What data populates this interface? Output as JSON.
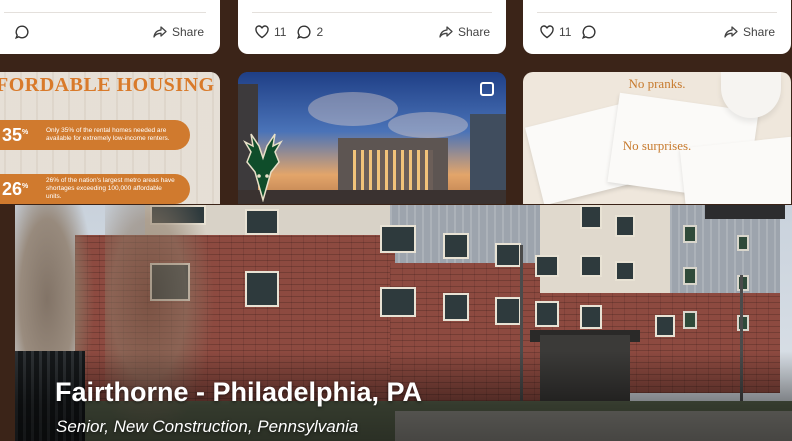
{
  "posts": [
    {
      "likes": "",
      "comments": "",
      "share_label": "Share"
    },
    {
      "likes": "11",
      "comments": "2",
      "share_label": "Share"
    },
    {
      "likes": "11",
      "comments": "",
      "share_label": "Share"
    }
  ],
  "tiles": {
    "housing": {
      "title": "FORDABLE HOUSING",
      "stats": [
        {
          "value": "35",
          "unit": "%",
          "text": "Only 35% of the rental homes needed are available for extremely low-income renters."
        },
        {
          "value": "26",
          "unit": "%",
          "text": "26% of the nation's largest metro areas have shortages exceeding 100,000 affordable units."
        }
      ]
    },
    "rendering": {
      "media_icon": "multiple-images-icon",
      "logo_icon": "deer-logo-icon"
    },
    "envelopes": {
      "line1": "No pranks.",
      "line2": "No surprises."
    }
  },
  "featured": {
    "title": "Fairthorne - Philadelphia, PA",
    "subtitle": "Senior, New Construction, Pennsylvania"
  },
  "colors": {
    "background": "#3b2418",
    "accent": "#d07a2e",
    "card": "#ffffff"
  }
}
